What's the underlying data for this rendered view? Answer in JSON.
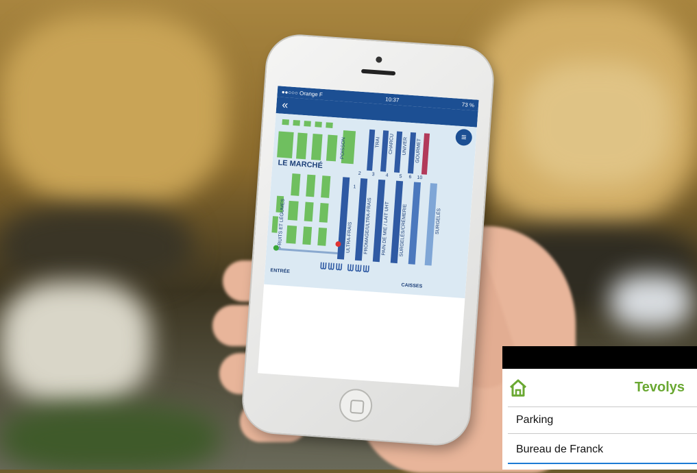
{
  "phone": {
    "status": {
      "carrier": "●●○○○ Orange F",
      "time": "10:37",
      "battery": "73 %"
    },
    "back_icon": "double-chevron-left-icon",
    "menu_icon": "hamburger-icon",
    "map": {
      "zone_title": "LE MARCHÉ",
      "labels": {
        "poisson": "POISSON",
        "traiteur": "TRAI",
        "charcuterie": "CHARCU",
        "univers": "UNIVER",
        "gourmet": "GOURMET",
        "fruits": "FRUITS ET LÉGUMES",
        "ultra_frais": "ULTRA-FRAIS",
        "fromage": "FROMAGE/ULTRA-FRAIS",
        "pain": "PAIN DE MIE / LAIT UHT",
        "surgeles": "SURGELÉS/CRÈMERIE",
        "surgeles2": "SURGELÉS",
        "entree": "ENTRÉE",
        "caisses": "CAISSES"
      },
      "aisle_numbers": [
        "2",
        "3",
        "4",
        "5",
        "6",
        "7",
        "8",
        "10",
        "1"
      ]
    }
  },
  "inset": {
    "brand": "Tevolys",
    "home_icon": "home-icon",
    "items": [
      "Parking",
      "Bureau de Franck"
    ]
  }
}
